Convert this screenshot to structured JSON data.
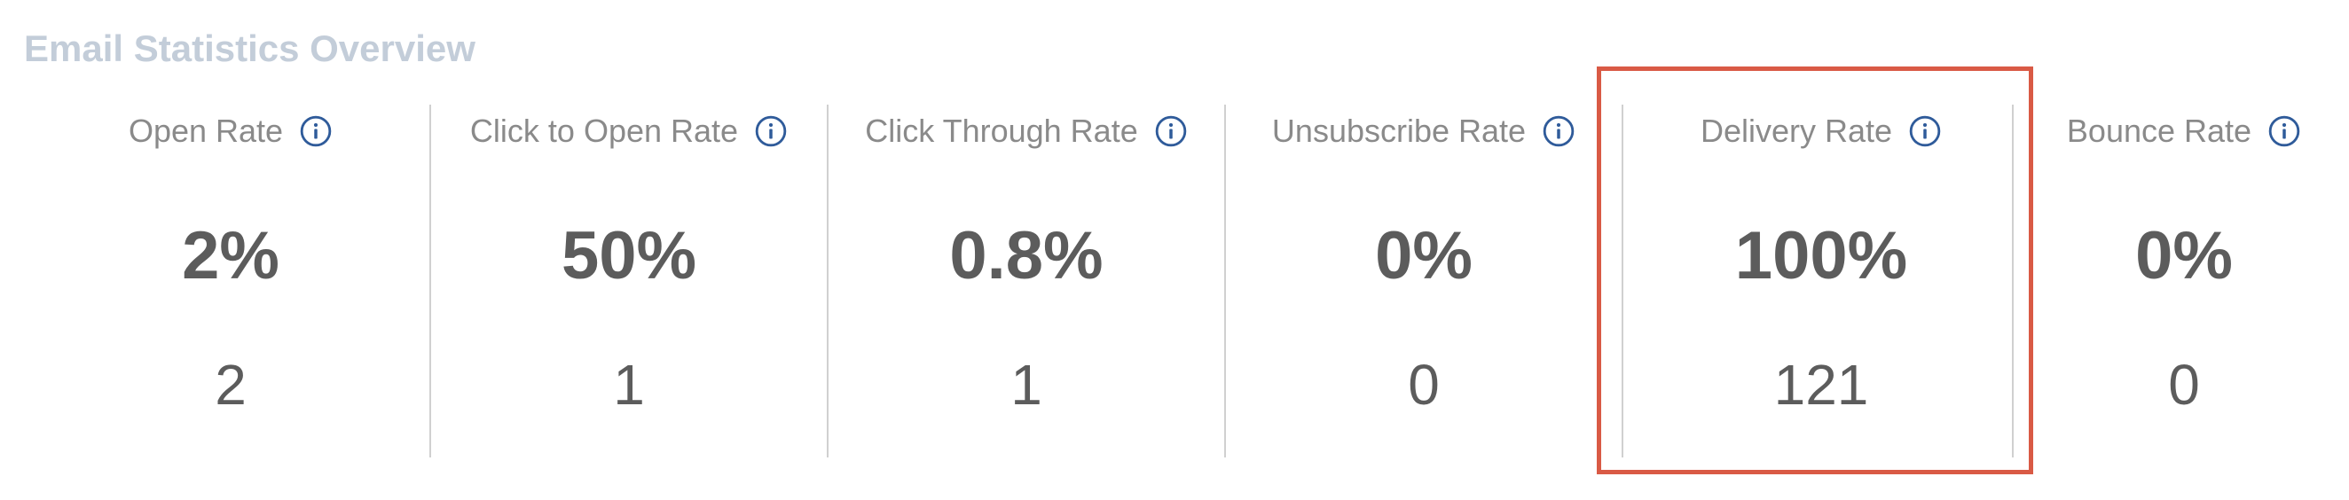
{
  "section": {
    "title": "Email Statistics Overview"
  },
  "stats": [
    {
      "label": "Open Rate",
      "percent": "2%",
      "count": "2",
      "icon": "info-icon"
    },
    {
      "label": "Click to Open Rate",
      "percent": "50%",
      "count": "1",
      "icon": "info-icon"
    },
    {
      "label": "Click Through Rate",
      "percent": "0.8%",
      "count": "1",
      "icon": "info-icon"
    },
    {
      "label": "Unsubscribe Rate",
      "percent": "0%",
      "count": "0",
      "icon": "info-icon"
    },
    {
      "label": "Delivery Rate",
      "percent": "100%",
      "count": "121",
      "icon": "info-icon",
      "highlighted": true
    },
    {
      "label": "Bounce Rate",
      "percent": "0%",
      "count": "0",
      "icon": "info-icon"
    }
  ],
  "colors": {
    "title": "#c3cdd9",
    "label": "#8a8a8a",
    "value": "#5c5c5c",
    "info_icon": "#2f5b9a",
    "divider": "#d0d0d0",
    "highlight": "#d95a45"
  }
}
